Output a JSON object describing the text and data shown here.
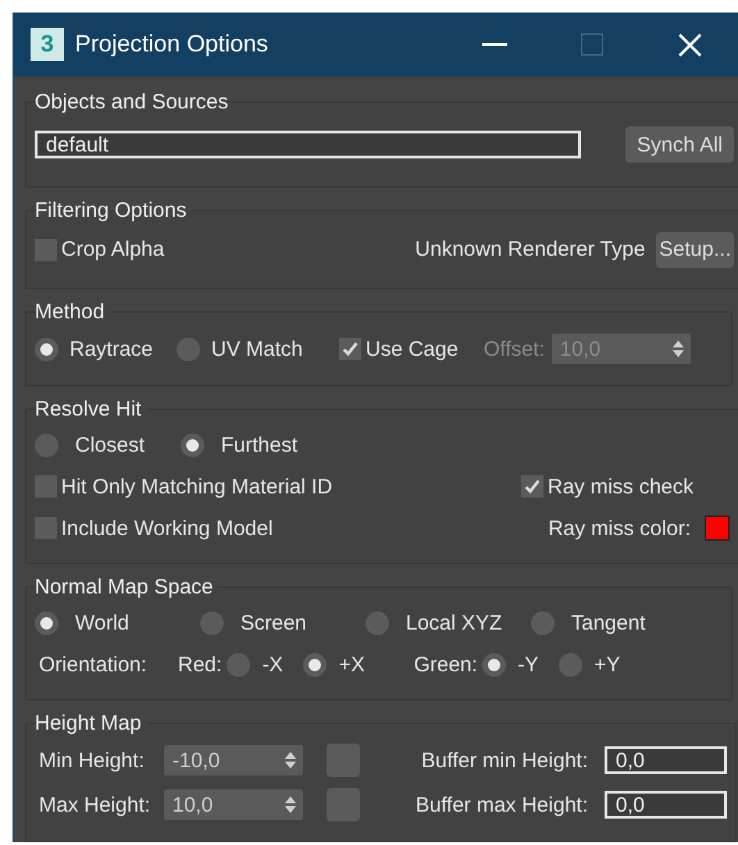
{
  "window": {
    "title": "Projection Options",
    "icon_label": "3"
  },
  "objects_and_sources": {
    "title": "Objects and Sources",
    "value": "default",
    "button": "Synch All"
  },
  "filtering_options": {
    "title": "Filtering Options",
    "crop_alpha": {
      "label": "Crop Alpha",
      "checked": false
    },
    "renderer_label": "Unknown Renderer Type",
    "button": "Setup..."
  },
  "method": {
    "title": "Method",
    "options": [
      {
        "label": "Raytrace",
        "selected": true
      },
      {
        "label": "UV Match",
        "selected": false
      }
    ],
    "use_cage": {
      "label": "Use Cage",
      "checked": true
    },
    "offset": {
      "label": "Offset:",
      "value": "10,0",
      "disabled": true
    }
  },
  "resolve_hit": {
    "title": "Resolve Hit",
    "options": [
      {
        "label": "Closest",
        "selected": false
      },
      {
        "label": "Furthest",
        "selected": true
      }
    ],
    "hit_only_matching": {
      "label": "Hit Only Matching Material ID",
      "checked": false
    },
    "ray_miss_check": {
      "label": "Ray miss check",
      "checked": true
    },
    "include_working_model": {
      "label": "Include Working Model",
      "checked": false
    },
    "ray_miss_color": {
      "label": "Ray miss color:",
      "color": "#ff0000"
    }
  },
  "normal_map_space": {
    "title": "Normal Map Space",
    "spaces": [
      {
        "label": "World",
        "selected": true
      },
      {
        "label": "Screen",
        "selected": false
      },
      {
        "label": "Local XYZ",
        "selected": false
      },
      {
        "label": "Tangent",
        "selected": false
      }
    ],
    "orientation_label": "Orientation:",
    "red": {
      "label": "Red:",
      "options": [
        {
          "label": "-X",
          "selected": false
        },
        {
          "label": "+X",
          "selected": true
        }
      ]
    },
    "green": {
      "label": "Green:",
      "options": [
        {
          "label": "-Y",
          "selected": true
        },
        {
          "label": "+Y",
          "selected": false
        }
      ]
    }
  },
  "height_map": {
    "title": "Height Map",
    "rows": [
      {
        "label": "Min Height:",
        "value": "-10,0",
        "buffer_label": "Buffer min Height:",
        "buffer_value": "0,0"
      },
      {
        "label": "Max Height:",
        "value": "10,0",
        "buffer_label": "Buffer max Height:",
        "buffer_value": "0,0"
      }
    ]
  }
}
